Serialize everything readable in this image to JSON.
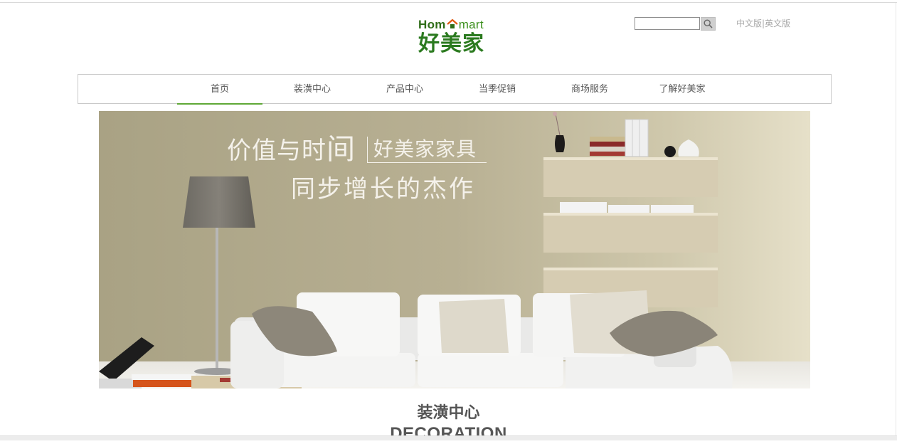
{
  "header": {
    "logo_en_prefix": "Hom",
    "logo_en_suffix": "mart",
    "logo_cn": "好美家",
    "search": {
      "value": "",
      "placeholder": ""
    },
    "lang_cn": "中文版",
    "lang_sep": "|",
    "lang_en": "英文版"
  },
  "nav": {
    "items": [
      {
        "label": "首页",
        "active": true
      },
      {
        "label": "装潢中心",
        "active": false
      },
      {
        "label": "产品中心",
        "active": false
      },
      {
        "label": "当季促销",
        "active": false
      },
      {
        "label": "商场服务",
        "active": false
      },
      {
        "label": "了解好美家",
        "active": false
      }
    ]
  },
  "banner": {
    "line1_a": "价值与时",
    "line1_b": "间",
    "line1_tag": "好美家家具",
    "line2": "同步增长的杰作"
  },
  "section": {
    "title": "装潢中心",
    "subtitle": "DECORATION"
  },
  "colors": {
    "brand_green": "#2b7a1f",
    "logo_house_roof": "#e05a14",
    "nav_active_underline": "#5fa836",
    "banner_wall": "#b7af90",
    "text_gray": "#555555"
  },
  "icons": {
    "search": "search-icon",
    "logo_house": "house-icon"
  }
}
